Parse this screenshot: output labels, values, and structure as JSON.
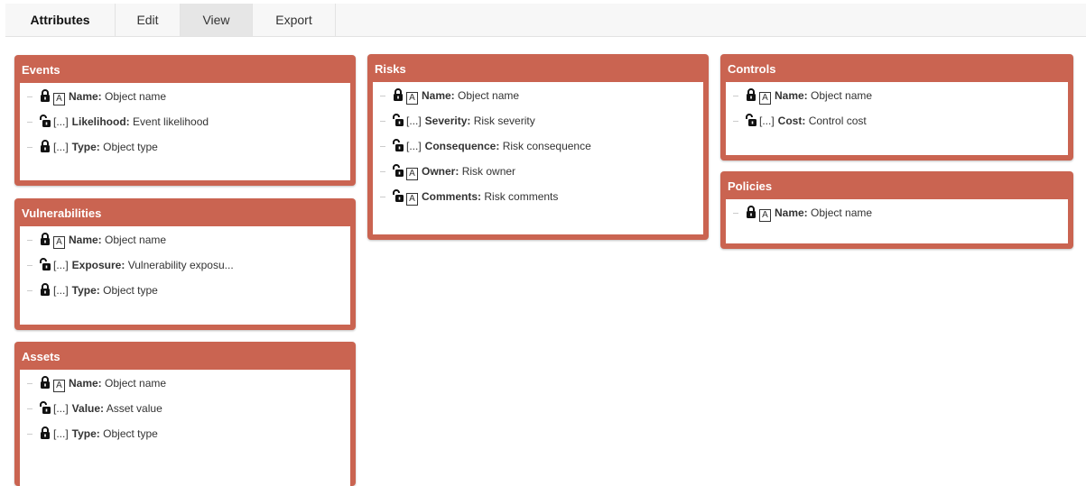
{
  "tabs": [
    {
      "label": "Attributes"
    },
    {
      "label": "Edit"
    },
    {
      "label": "View"
    },
    {
      "label": "Export"
    }
  ],
  "colors": {
    "panel_header": "#ca6451",
    "tab_bar": "#f7f7f7",
    "tab_shaded": "#e6e6e6"
  },
  "panels": {
    "events": {
      "title": "Events",
      "items": [
        {
          "lock": "locked",
          "kind": "A",
          "label": "Name:",
          "desc": "Object name"
        },
        {
          "lock": "unlocked",
          "kind": "[...]",
          "label": "Likelihood:",
          "desc": "Event likelihood"
        },
        {
          "lock": "locked",
          "kind": "[...]",
          "label": "Type:",
          "desc": "Object type"
        }
      ]
    },
    "vulnerabilities": {
      "title": "Vulnerabilities",
      "items": [
        {
          "lock": "locked",
          "kind": "A",
          "label": "Name:",
          "desc": "Object name"
        },
        {
          "lock": "unlocked",
          "kind": "[...]",
          "label": "Exposure:",
          "desc": "Vulnerability exposu..."
        },
        {
          "lock": "locked",
          "kind": "[...]",
          "label": "Type:",
          "desc": "Object type"
        }
      ]
    },
    "assets": {
      "title": "Assets",
      "items": [
        {
          "lock": "locked",
          "kind": "A",
          "label": "Name:",
          "desc": "Object name"
        },
        {
          "lock": "unlocked",
          "kind": "[...]",
          "label": "Value:",
          "desc": "Asset value"
        },
        {
          "lock": "locked",
          "kind": "[...]",
          "label": "Type:",
          "desc": "Object type"
        }
      ]
    },
    "risks": {
      "title": "Risks",
      "items": [
        {
          "lock": "locked",
          "kind": "A",
          "label": "Name:",
          "desc": "Object name"
        },
        {
          "lock": "unlocked",
          "kind": "[...]",
          "label": "Severity:",
          "desc": "Risk severity"
        },
        {
          "lock": "unlocked",
          "kind": "[...]",
          "label": "Consequence:",
          "desc": "Risk consequence"
        },
        {
          "lock": "unlocked",
          "kind": "A",
          "label": "Owner:",
          "desc": "Risk owner"
        },
        {
          "lock": "unlocked",
          "kind": "A",
          "label": "Comments:",
          "desc": "Risk comments"
        }
      ]
    },
    "controls": {
      "title": "Controls",
      "items": [
        {
          "lock": "locked",
          "kind": "A",
          "label": "Name:",
          "desc": "Object name"
        },
        {
          "lock": "unlocked",
          "kind": "[...]",
          "label": "Cost:",
          "desc": "Control cost"
        }
      ]
    },
    "policies": {
      "title": "Policies",
      "items": [
        {
          "lock": "locked",
          "kind": "A",
          "label": "Name:",
          "desc": "Object name"
        }
      ]
    }
  }
}
